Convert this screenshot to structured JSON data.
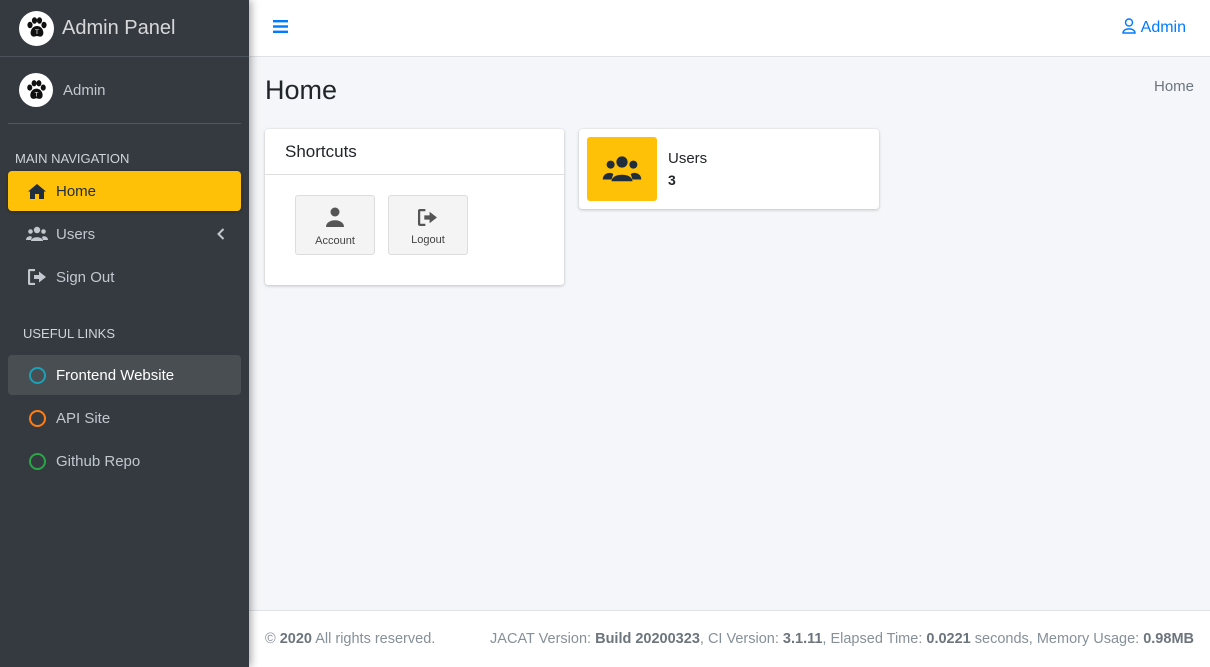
{
  "brand": {
    "title": "Admin Panel"
  },
  "user": {
    "name": "Admin"
  },
  "sidebar": {
    "main_header": "MAIN NAVIGATION",
    "links_header": "USEFUL LINKS",
    "nav": [
      {
        "label": "Home",
        "icon": "home-icon",
        "active": true
      },
      {
        "label": "Users",
        "icon": "users-icon"
      },
      {
        "label": "Sign Out",
        "icon": "sign-out-icon"
      }
    ],
    "links": [
      {
        "label": "Frontend Website",
        "color": "#17a2b8"
      },
      {
        "label": "API Site",
        "color": "#fd7e14"
      },
      {
        "label": "Github Repo",
        "color": "#28a745"
      }
    ]
  },
  "header": {
    "user_label": "Admin"
  },
  "main": {
    "title": "Home",
    "breadcrumb": "Home",
    "shortcuts": {
      "title": "Shortcuts",
      "items": [
        {
          "label": "Account",
          "icon": "user-icon"
        },
        {
          "label": "Logout",
          "icon": "logout-icon"
        }
      ]
    },
    "stats": {
      "label": "Users",
      "value": "3"
    }
  },
  "footer": {
    "copyright_symbol": "©",
    "year": "2020",
    "rights": "All rights reserved.",
    "jacat_label": "JACAT Version:",
    "jacat_value": "Build 20200323",
    "ci_label": ", CI Version:",
    "ci_value": "3.1.11",
    "elapsed_label": ", Elapsed Time:",
    "elapsed_value": "0.0221",
    "seconds_label": "seconds, Memory Usage:",
    "memory_value": "0.98MB"
  },
  "colors": {
    "accent": "#ffc107",
    "link": "#007bff",
    "sidebar": "#343a40"
  }
}
